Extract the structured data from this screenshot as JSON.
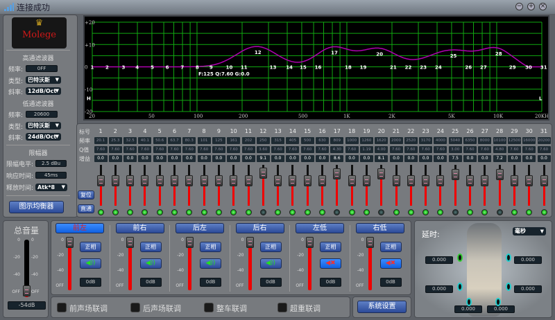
{
  "window": {
    "title": "连接成功",
    "controls": [
      "minimize",
      "maximize",
      "close"
    ]
  },
  "logo": {
    "text": "Molege"
  },
  "highpass": {
    "title": "高通滤波器",
    "freq_label": "频率:",
    "freq": "0FF",
    "type_label": "类型:",
    "type": "巴特沃斯",
    "slope_label": "斜率:",
    "slope": "12dB/Oct"
  },
  "lowpass": {
    "title": "低通滤波器",
    "freq_label": "频率:",
    "freq": "20600",
    "type_label": "类型:",
    "type": "巴特沃斯",
    "slope_label": "斜率:",
    "slope": "24dB/Oct"
  },
  "limiter": {
    "title": "限幅器",
    "level_label": "限幅电平:",
    "level": "2.5 dBu",
    "attack_label": "响应时间:",
    "attack": "45ms",
    "release_label": "释放时间:",
    "release": "Atk*8"
  },
  "graphic_eq_button": "图示均衡器",
  "graph": {
    "y_ticks": [
      "+20",
      "+10",
      "0",
      "-10",
      "-20"
    ],
    "x_ticks": [
      "20",
      "50",
      "100",
      "200",
      "500",
      "1K",
      "2K",
      "5K",
      "10K",
      "20KHz"
    ],
    "readout": "F:125 Q:7.60 G:0.0",
    "hp_marker": "H",
    "lp_marker": "L",
    "curve_color": "#b000b0",
    "grid_color": "#11aa11"
  },
  "eq": {
    "row_labels": [
      "标号",
      "频率",
      "Q值",
      "增益"
    ],
    "reset_label": "复位",
    "bypass_label": "直通",
    "gain_range": [
      -12,
      12
    ],
    "bands": [
      {
        "n": "1",
        "f": "20.1",
        "q": "7.60",
        "g": "0.0"
      },
      {
        "n": "2",
        "f": "25.3",
        "q": "7.60",
        "g": "0.0"
      },
      {
        "n": "3",
        "f": "32.5",
        "q": "7.60",
        "g": "0.0"
      },
      {
        "n": "4",
        "f": "40.1",
        "q": "7.60",
        "g": "0.0"
      },
      {
        "n": "5",
        "f": "50.6",
        "q": "7.60",
        "g": "0.0"
      },
      {
        "n": "6",
        "f": "63.7",
        "q": "7.60",
        "g": "0.0"
      },
      {
        "n": "7",
        "f": "80.3",
        "q": "7.60",
        "g": "0.0"
      },
      {
        "n": "8",
        "f": "101",
        "q": "7.60",
        "g": "0.0"
      },
      {
        "n": "9",
        "f": "125",
        "q": "7.60",
        "g": "0.0"
      },
      {
        "n": "10",
        "f": "161",
        "q": "7.60",
        "g": "0.0"
      },
      {
        "n": "11",
        "f": "202",
        "q": "7.60",
        "g": "0.0"
      },
      {
        "n": "12",
        "f": "250",
        "q": "3.60",
        "g": "9.1"
      },
      {
        "n": "13",
        "f": "315",
        "q": "7.60",
        "g": "0.0"
      },
      {
        "n": "14",
        "f": "405",
        "q": "7.60",
        "g": "0.0"
      },
      {
        "n": "15",
        "f": "500",
        "q": "7.60",
        "g": "0.0"
      },
      {
        "n": "16",
        "f": "630",
        "q": "7.60",
        "g": "0.0"
      },
      {
        "n": "17",
        "f": "809",
        "q": "4.30",
        "g": "8.6"
      },
      {
        "n": "18",
        "f": "1000",
        "q": "7.60",
        "g": "0.0"
      },
      {
        "n": "19",
        "f": "1260",
        "q": "1.19",
        "g": "0.0"
      },
      {
        "n": "20",
        "f": "1620",
        "q": "4.00",
        "g": "8.1"
      },
      {
        "n": "21",
        "f": "2000",
        "q": "7.60",
        "g": "0.0"
      },
      {
        "n": "22",
        "f": "2520",
        "q": "7.60",
        "g": "0.0"
      },
      {
        "n": "23",
        "f": "3170",
        "q": "7.60",
        "g": "0.0"
      },
      {
        "n": "24",
        "f": "4000",
        "q": "7.60",
        "g": "0.0"
      },
      {
        "n": "25",
        "f": "5040",
        "q": "3.00",
        "g": "7.5"
      },
      {
        "n": "26",
        "f": "6350",
        "q": "7.60",
        "g": "0.0"
      },
      {
        "n": "27",
        "f": "8000",
        "q": "7.60",
        "g": "0.0"
      },
      {
        "n": "28",
        "f": "10100",
        "q": "4.80",
        "g": "7.2"
      },
      {
        "n": "29",
        "f": "12500",
        "q": "7.60",
        "g": "0.0"
      },
      {
        "n": "30",
        "f": "16000",
        "q": "7.60",
        "g": "0.0"
      },
      {
        "n": "31",
        "f": "20200",
        "q": "7.60",
        "g": "0.0"
      }
    ]
  },
  "master": {
    "title": "总音量",
    "scale": [
      "0",
      "-20",
      "-40",
      "OFF"
    ],
    "value": "-54dB",
    "level_db": -54
  },
  "channels": [
    {
      "name": "前左",
      "selected": true,
      "phase": "正相",
      "muted": false,
      "value": "0dB"
    },
    {
      "name": "前右",
      "selected": false,
      "phase": "正相",
      "muted": false,
      "value": "0dB"
    },
    {
      "name": "后左",
      "selected": false,
      "phase": "正相",
      "muted": false,
      "value": "0dB"
    },
    {
      "name": "后右",
      "selected": false,
      "phase": "正相",
      "muted": false,
      "value": "0dB"
    },
    {
      "name": "左低",
      "selected": false,
      "phase": "正相",
      "muted": true,
      "value": "0dB"
    },
    {
      "name": "右低",
      "selected": false,
      "phase": "正相",
      "muted": true,
      "value": "0dB"
    }
  ],
  "channel_scale": [
    "0",
    "-20",
    "-40",
    "OFF"
  ],
  "links": [
    "前声场联调",
    "后声场联调",
    "整车联调",
    "超重联调"
  ],
  "system_settings": "系统设置",
  "delay": {
    "title": "延时:",
    "unit": "毫秒",
    "values": [
      "0.000",
      "0.000",
      "0.000",
      "0.000",
      "0.000",
      "0.000"
    ]
  }
}
